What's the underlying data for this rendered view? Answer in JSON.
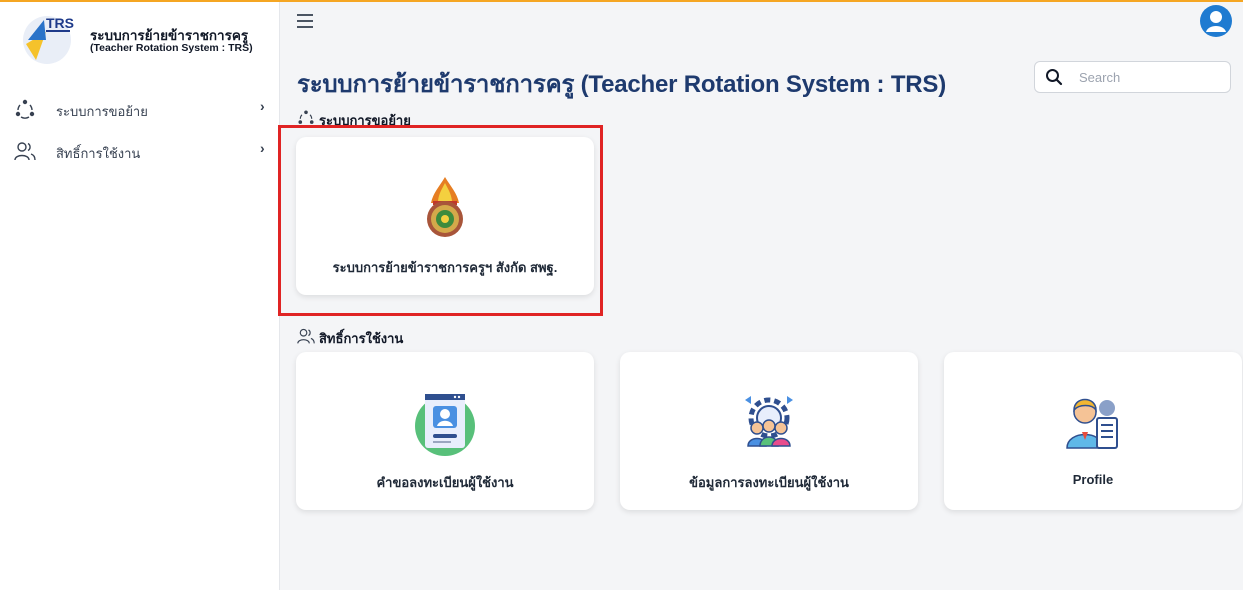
{
  "brand": {
    "logo_text": "TRS",
    "title": "ระบบการย้ายข้าราชการครู",
    "subtitle": "(Teacher Rotation System : TRS)"
  },
  "sidebar": {
    "items": [
      {
        "label": "ระบบการขอย้าย",
        "icon": "transfer-cycle-icon"
      },
      {
        "label": "สิทธิ์การใช้งาน",
        "icon": "users-icon"
      }
    ]
  },
  "header": {
    "page_title": "ระบบการย้ายข้าราชการครู (Teacher Rotation System : TRS)",
    "search_placeholder": "Search"
  },
  "sections": {
    "transfer": {
      "title": "ระบบการขอย้าย",
      "cards": [
        {
          "label": "ระบบการย้ายข้าราชการครูฯ สังกัด สพฐ.",
          "icon": "obec-emblem-icon"
        }
      ]
    },
    "permissions": {
      "title": "สิทธิ์การใช้งาน",
      "cards": [
        {
          "label": "คำขอลงทะเบียนผู้ใช้งาน",
          "icon": "user-registration-icon"
        },
        {
          "label": "ข้อมูลการลงทะเบียนผู้ใช้งาน",
          "icon": "team-settings-icon"
        },
        {
          "label": "Profile",
          "icon": "profile-icon"
        }
      ]
    }
  },
  "colors": {
    "accent": "#f5a623",
    "title": "#1e3a6e",
    "highlight": "#e02424",
    "avatar": "#1f7bd1"
  }
}
